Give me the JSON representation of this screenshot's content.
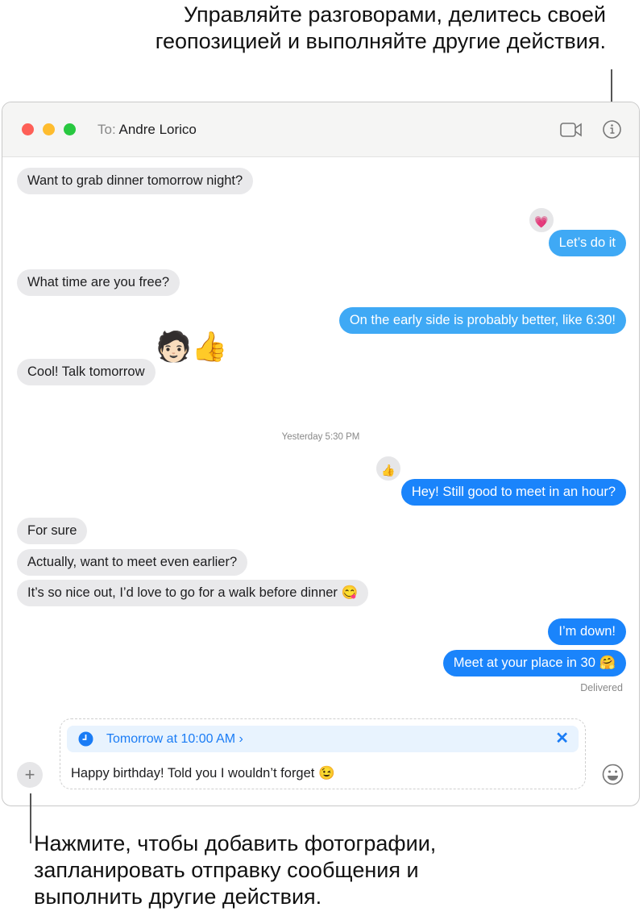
{
  "callouts": {
    "top": "Управляйте разговорами, делитесь своей геопозицией и выполняйте другие действия.",
    "bottom": "Нажмите, чтобы добавить фотографии, запланировать отправку сообщения и выполнить другие действия."
  },
  "header": {
    "to_label": "To:",
    "recipient": "Andre Lorico"
  },
  "messages": [
    {
      "text": "Want to grab dinner tomorrow night?",
      "dir": "in"
    },
    {
      "text": "Let’s do it",
      "dir": "out",
      "tapback": "💗"
    },
    {
      "text": "What time are you free?",
      "dir": "in"
    },
    {
      "text": "On the early side is probably better, like 6:30!",
      "dir": "out"
    },
    {
      "text": "Cool! Talk tomorrow",
      "dir": "in",
      "sticker": "🧑🏻👍"
    },
    {
      "text": "Hey! Still good to meet in an hour?",
      "dir": "out",
      "tapback": "👍"
    },
    {
      "text": "For sure",
      "dir": "in"
    },
    {
      "text": "Actually, want to meet even earlier?",
      "dir": "in"
    },
    {
      "text": "It’s so nice out, I’d love to go for a walk before dinner 😋",
      "dir": "in"
    },
    {
      "text": "I’m down!",
      "dir": "out"
    },
    {
      "text": "Meet at your place in 30 🤗",
      "dir": "out"
    }
  ],
  "timestamp": "Yesterday 5:30 PM",
  "status": "Delivered",
  "compose": {
    "schedule": "Tomorrow at 10:00 AM ›",
    "text": "Happy birthday! Told you I wouldn’t forget 😉"
  },
  "colors": {
    "sent": "#1a84fb",
    "received": "#e9e9eb"
  }
}
